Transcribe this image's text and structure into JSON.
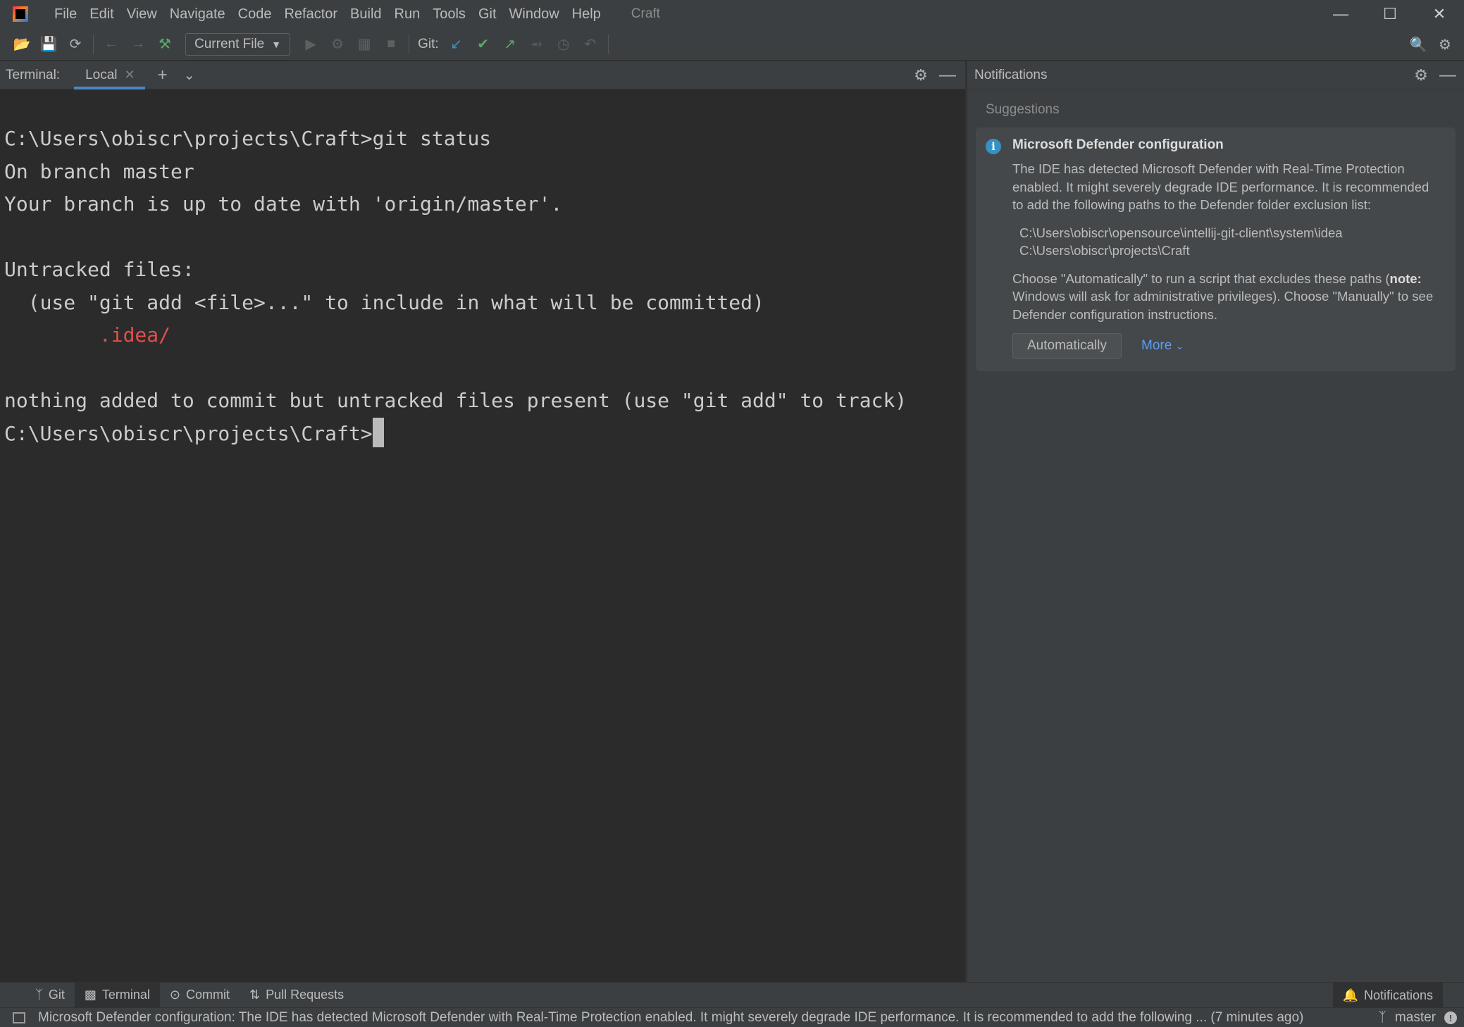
{
  "menu": [
    "File",
    "Edit",
    "View",
    "Navigate",
    "Code",
    "Refactor",
    "Build",
    "Run",
    "Tools",
    "Git",
    "Window",
    "Help"
  ],
  "project_name": "Craft",
  "toolbar": {
    "run_config": "Current File",
    "git_label": "Git:"
  },
  "terminal": {
    "title": "Terminal:",
    "tab": "Local",
    "lines": [
      "C:\\Users\\obiscr\\projects\\Craft>git status",
      "On branch master",
      "Your branch is up to date with 'origin/master'.",
      "",
      "Untracked files:",
      "  (use \"git add <file>...\" to include in what will be committed)",
      "        .idea/",
      "",
      "nothing added to commit but untracked files present (use \"git add\" to track)",
      "C:\\Users\\obiscr\\projects\\Craft>"
    ]
  },
  "notifications": {
    "title": "Notifications",
    "section": "Suggestions",
    "card": {
      "title": "Microsoft Defender configuration",
      "body": "The IDE has detected Microsoft Defender with Real-Time Protection enabled. It might severely degrade IDE performance. It is recommended to add the following paths to the Defender folder exclusion list:",
      "path1": "C:\\Users\\obiscr\\opensource\\intellij-git-client\\system\\idea",
      "path2": "C:\\Users\\obiscr\\projects\\Craft",
      "instr_pre": "Choose \"Automatically\" to run a script that excludes these paths (",
      "instr_note": "note:",
      "instr_post": " Windows will ask for administrative privileges). Choose \"Manually\" to see Defender configuration instructions.",
      "btn_auto": "Automatically",
      "btn_more": "More"
    }
  },
  "tools": {
    "git": "Git",
    "terminal": "Terminal",
    "commit": "Commit",
    "pull_requests": "Pull Requests",
    "notifications": "Notifications"
  },
  "status": {
    "message": "Microsoft Defender configuration: The IDE has detected Microsoft Defender with Real-Time Protection enabled. It might severely degrade IDE performance. It is recommended to add the following ... (7 minutes ago)",
    "branch": "master"
  },
  "colors": {
    "accent": "#4a88c7",
    "untracked": "#e0504a",
    "link": "#589df6"
  }
}
